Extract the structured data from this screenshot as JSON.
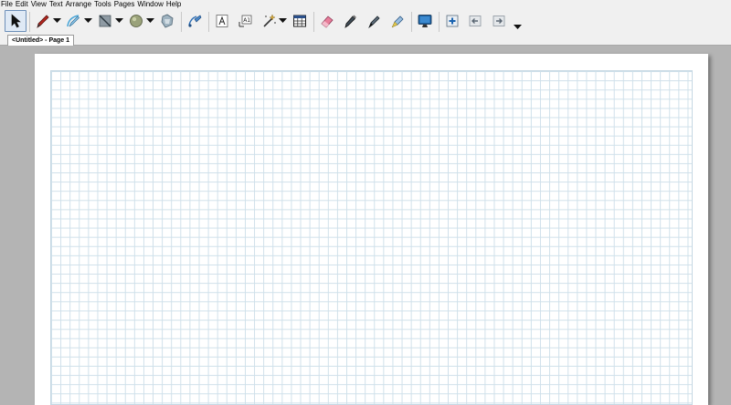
{
  "menu": [
    "File",
    "Edit",
    "View",
    "Text",
    "Arrange",
    "Tools",
    "Pages",
    "Window",
    "Help"
  ],
  "toolbar": {
    "tools": [
      {
        "icon": "select-arrow-icon",
        "active": true
      },
      {
        "icon": "pen-icon"
      },
      {
        "icon": "shape-recognition-pen-icon"
      },
      {
        "icon": "lines-icon"
      },
      {
        "icon": "shapes-icon"
      },
      {
        "icon": "magic-pen-icon"
      },
      {
        "icon": "fill-icon"
      },
      {
        "icon": "text-icon"
      },
      {
        "icon": "text-box-icon"
      },
      {
        "icon": "properties-wand-icon"
      },
      {
        "icon": "table-icon"
      },
      {
        "icon": "eraser-icon"
      },
      {
        "icon": "creative-pen-icon"
      },
      {
        "icon": "calligraphic-pen-icon"
      },
      {
        "icon": "highlighter-icon"
      },
      {
        "icon": "screen-display-icon"
      },
      {
        "icon": "add-page-icon"
      },
      {
        "icon": "previous-page-icon"
      },
      {
        "icon": "next-page-icon"
      },
      {
        "icon": "toolbar-overflow-icon"
      }
    ]
  },
  "tabs": [
    {
      "label": "<Untitled> - Page 1"
    }
  ],
  "colors": {
    "chrome": "#f0f0f0",
    "workspace": "#b4b4b4",
    "page": "#ffffff",
    "grid_line": "#cfe0ea"
  }
}
